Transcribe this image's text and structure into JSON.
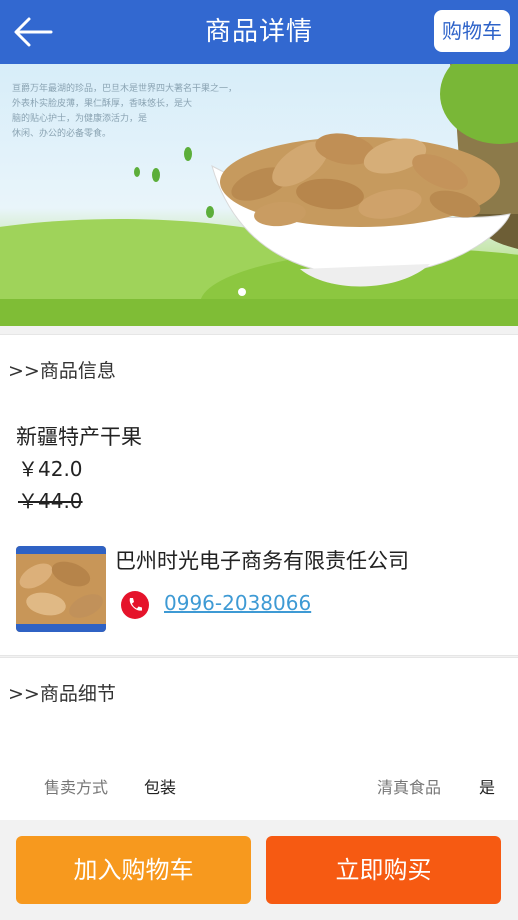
{
  "header": {
    "title": "商品详情",
    "cart_label": "购物车"
  },
  "banner": {
    "text_lines": [
      "亘爵万年最湖的珍品，巴旦木是世界四大著名干果之一，",
      "外表朴实脸皮薄，果仁酥厚，香味悠长，是大",
      "脑的贴心护士，为健康添活力，是",
      "休闲、办公的必备零食。"
    ]
  },
  "sections": {
    "info_title": ">>商品信息",
    "detail_title": ">>商品细节"
  },
  "product": {
    "name": "新疆特产干果",
    "price": "￥42.0",
    "old_price": "￥44.0"
  },
  "shop": {
    "name": "巴州时光电子商务有限责任公司",
    "phone": "0996-2038066"
  },
  "details": [
    {
      "label": "售卖方式",
      "value": "包装"
    },
    {
      "label": "清真食品",
      "value": "是"
    }
  ],
  "actions": {
    "add_to_cart": "加入购物车",
    "buy_now": "立即购买"
  },
  "colors": {
    "header": "#3268d0",
    "cart_button": "#f7991e",
    "buy_button": "#f65a12",
    "link": "#3e9ad4"
  }
}
